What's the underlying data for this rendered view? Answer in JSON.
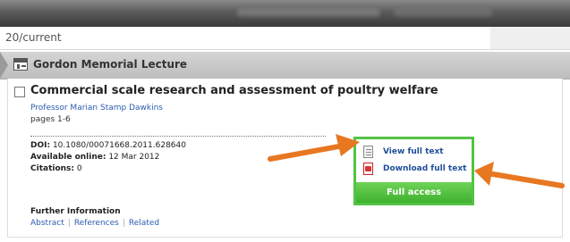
{
  "browser": {
    "url_fragment": "20/current"
  },
  "section": {
    "title": "Gordon Memorial Lecture",
    "icon": "journal-section-icon"
  },
  "article": {
    "title": "Commercial scale research and assessment of poultry welfare",
    "author": "Professor Marian Stamp Dawkins",
    "pages": "pages 1-6",
    "doi_label": "DOI:",
    "doi_value": " 10.1080/00071668.2011.628640",
    "available_label": "Available online:",
    "available_value": " 12 Mar 2012",
    "citations_label": "Citations:",
    "citations_value": " 0",
    "further_information_label": "Further Information",
    "further_links": [
      "Abstract",
      "References",
      "Related"
    ]
  },
  "access": {
    "view_full_text": "View full text",
    "download_full_text": "Download full text",
    "full_access": "Full access",
    "border_color": "#54c345",
    "button_color": "#4cbf3a"
  },
  "annotations": {
    "arrow_color": "#e87722",
    "arrow_icon": "annotation-arrow-icon"
  }
}
